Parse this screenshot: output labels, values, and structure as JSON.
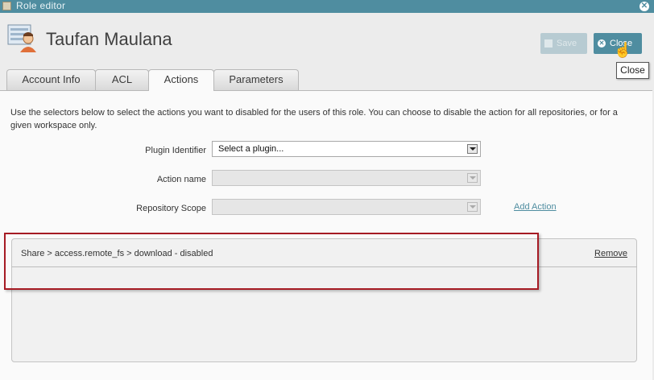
{
  "window": {
    "title": "Role editor",
    "close_icon": "x-icon"
  },
  "header": {
    "user_name": "Taufan Maulana",
    "avatar_icon": "user-card-icon",
    "save_label": "Save",
    "close_label": "Close",
    "tooltip": "Close"
  },
  "tabs": [
    {
      "label": "Account Info",
      "active": false
    },
    {
      "label": "ACL",
      "active": false
    },
    {
      "label": "Actions",
      "active": true
    },
    {
      "label": "Parameters",
      "active": false
    }
  ],
  "actions": {
    "intro": "Use the selectors below to select the actions you want to disabled for the users of this role. You can choose to disable the action for all repositories, or for a given workspace only.",
    "plugin_label": "Plugin Identifier",
    "plugin_value": "Select a plugin...",
    "action_label": "Action name",
    "action_value": "",
    "scope_label": "Repository Scope",
    "scope_value": "",
    "add_action": "Add Action"
  },
  "rules": [
    {
      "text": "Share > access.remote_fs > download - disabled",
      "remove_label": "Remove"
    }
  ],
  "colors": {
    "accent": "#4f8da0",
    "highlight": "#a61b24"
  }
}
